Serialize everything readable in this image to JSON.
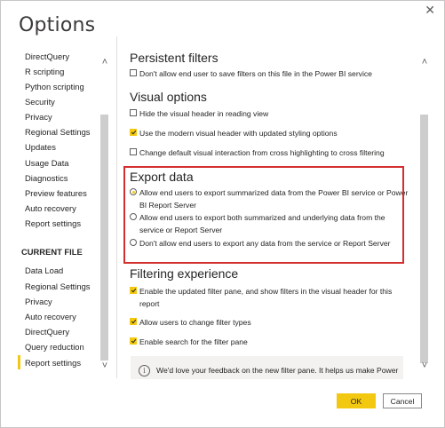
{
  "window": {
    "title": "Options",
    "close_glyph": "✕"
  },
  "nav": {
    "global_items": [
      "DirectQuery",
      "R scripting",
      "Python scripting",
      "Security",
      "Privacy",
      "Regional Settings",
      "Updates",
      "Usage Data",
      "Diagnostics",
      "Preview features",
      "Auto recovery",
      "Report settings"
    ],
    "current_file_header": "CURRENT FILE",
    "current_file_items": [
      "Data Load",
      "Regional Settings",
      "Privacy",
      "Auto recovery",
      "DirectQuery",
      "Query reduction",
      "Report settings"
    ],
    "selected": "Report settings"
  },
  "sections": {
    "persistent_filters": {
      "title": "Persistent filters",
      "options": [
        {
          "label": "Don't allow end user to save filters on this file in the Power BI service",
          "checked": false
        }
      ]
    },
    "visual_options": {
      "title": "Visual options",
      "options": [
        {
          "label": "Hide the visual header in reading view",
          "checked": false
        },
        {
          "label": "Use the modern visual header with updated styling options",
          "checked": true
        },
        {
          "label": "Change default visual interaction from cross highlighting to cross filtering",
          "checked": false
        }
      ]
    },
    "export_data": {
      "title": "Export data",
      "options": [
        {
          "label": "Allow end users to export summarized data from the Power BI service or Power BI Report Server",
          "selected": true
        },
        {
          "label": "Allow end users to export both summarized and underlying data from the service or Report Server",
          "selected": false
        },
        {
          "label": "Don't allow end users to export any data from the service or Report Server",
          "selected": false
        }
      ]
    },
    "filtering_experience": {
      "title": "Filtering experience",
      "options": [
        {
          "label": "Enable the updated filter pane, and show filters in the visual header for this report",
          "checked": true
        },
        {
          "label": "Allow users to change filter types",
          "checked": true
        },
        {
          "label": "Enable search for the filter pane",
          "checked": true
        }
      ],
      "info_text": "We'd love your feedback on the new filter pane. It helps us make Power BI better. Share feedback"
    }
  },
  "footer": {
    "ok_label": "OK",
    "cancel_label": "Cancel"
  },
  "colors": {
    "accent": "#f2c811",
    "highlight_border": "#d32f2f",
    "info_bg": "#f3f2f1"
  }
}
